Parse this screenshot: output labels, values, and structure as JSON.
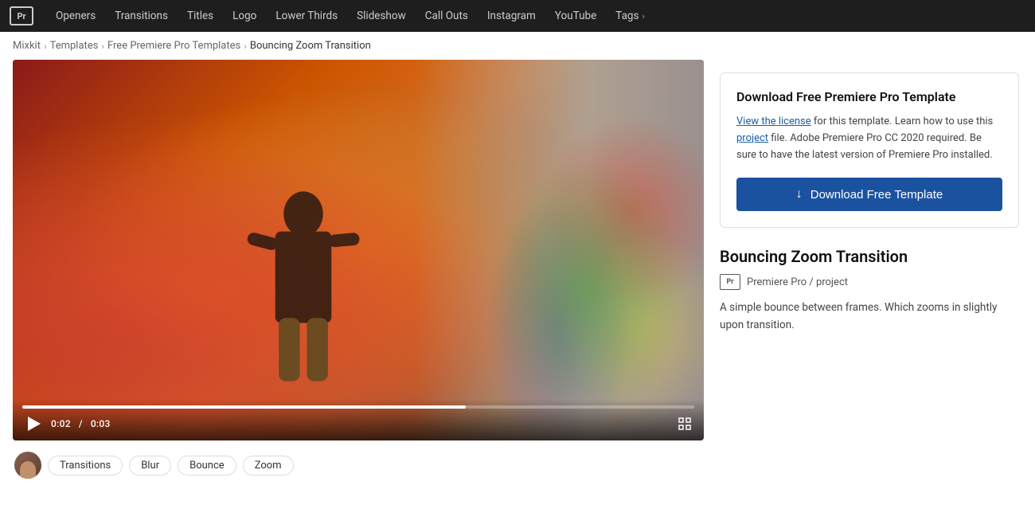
{
  "navbar": {
    "logo_text": "Pr",
    "items": [
      {
        "label": "Openers",
        "id": "openers"
      },
      {
        "label": "Transitions",
        "id": "transitions"
      },
      {
        "label": "Titles",
        "id": "titles"
      },
      {
        "label": "Logo",
        "id": "logo"
      },
      {
        "label": "Lower Thirds",
        "id": "lower-thirds"
      },
      {
        "label": "Slideshow",
        "id": "slideshow"
      },
      {
        "label": "Call Outs",
        "id": "call-outs"
      },
      {
        "label": "Instagram",
        "id": "instagram"
      },
      {
        "label": "YouTube",
        "id": "youtube"
      },
      {
        "label": "Tags",
        "id": "tags"
      }
    ]
  },
  "breadcrumb": {
    "items": [
      {
        "label": "Mixkit",
        "id": "mixkit"
      },
      {
        "label": "Templates",
        "id": "templates"
      },
      {
        "label": "Free Premiere Pro Templates",
        "id": "free-templates"
      },
      {
        "label": "Bouncing Zoom Transition",
        "id": "current"
      }
    ]
  },
  "video": {
    "current_time": "0:02",
    "total_time": "0:03",
    "separator": "/"
  },
  "tags": [
    {
      "label": "Transitions",
      "id": "transitions"
    },
    {
      "label": "Blur",
      "id": "blur"
    },
    {
      "label": "Bounce",
      "id": "bounce"
    },
    {
      "label": "Zoom",
      "id": "zoom"
    }
  ],
  "sidebar": {
    "download_card": {
      "title": "Download Free Premiere Pro Template",
      "description_pre": "",
      "license_link_text": "View the license",
      "description_mid": " for this template. Learn how to use this ",
      "project_link_text": "project",
      "description_post": " file. Adobe Premiere Pro CC 2020 required. Be sure to have the latest version of Premiere Pro installed.",
      "button_label": "Download Free Template"
    },
    "template": {
      "title": "Bouncing Zoom Transition",
      "badge_text": "Pr",
      "type_label": "Premiere Pro / project",
      "description": "A simple bounce between frames. Which zooms in slightly upon transition."
    }
  }
}
